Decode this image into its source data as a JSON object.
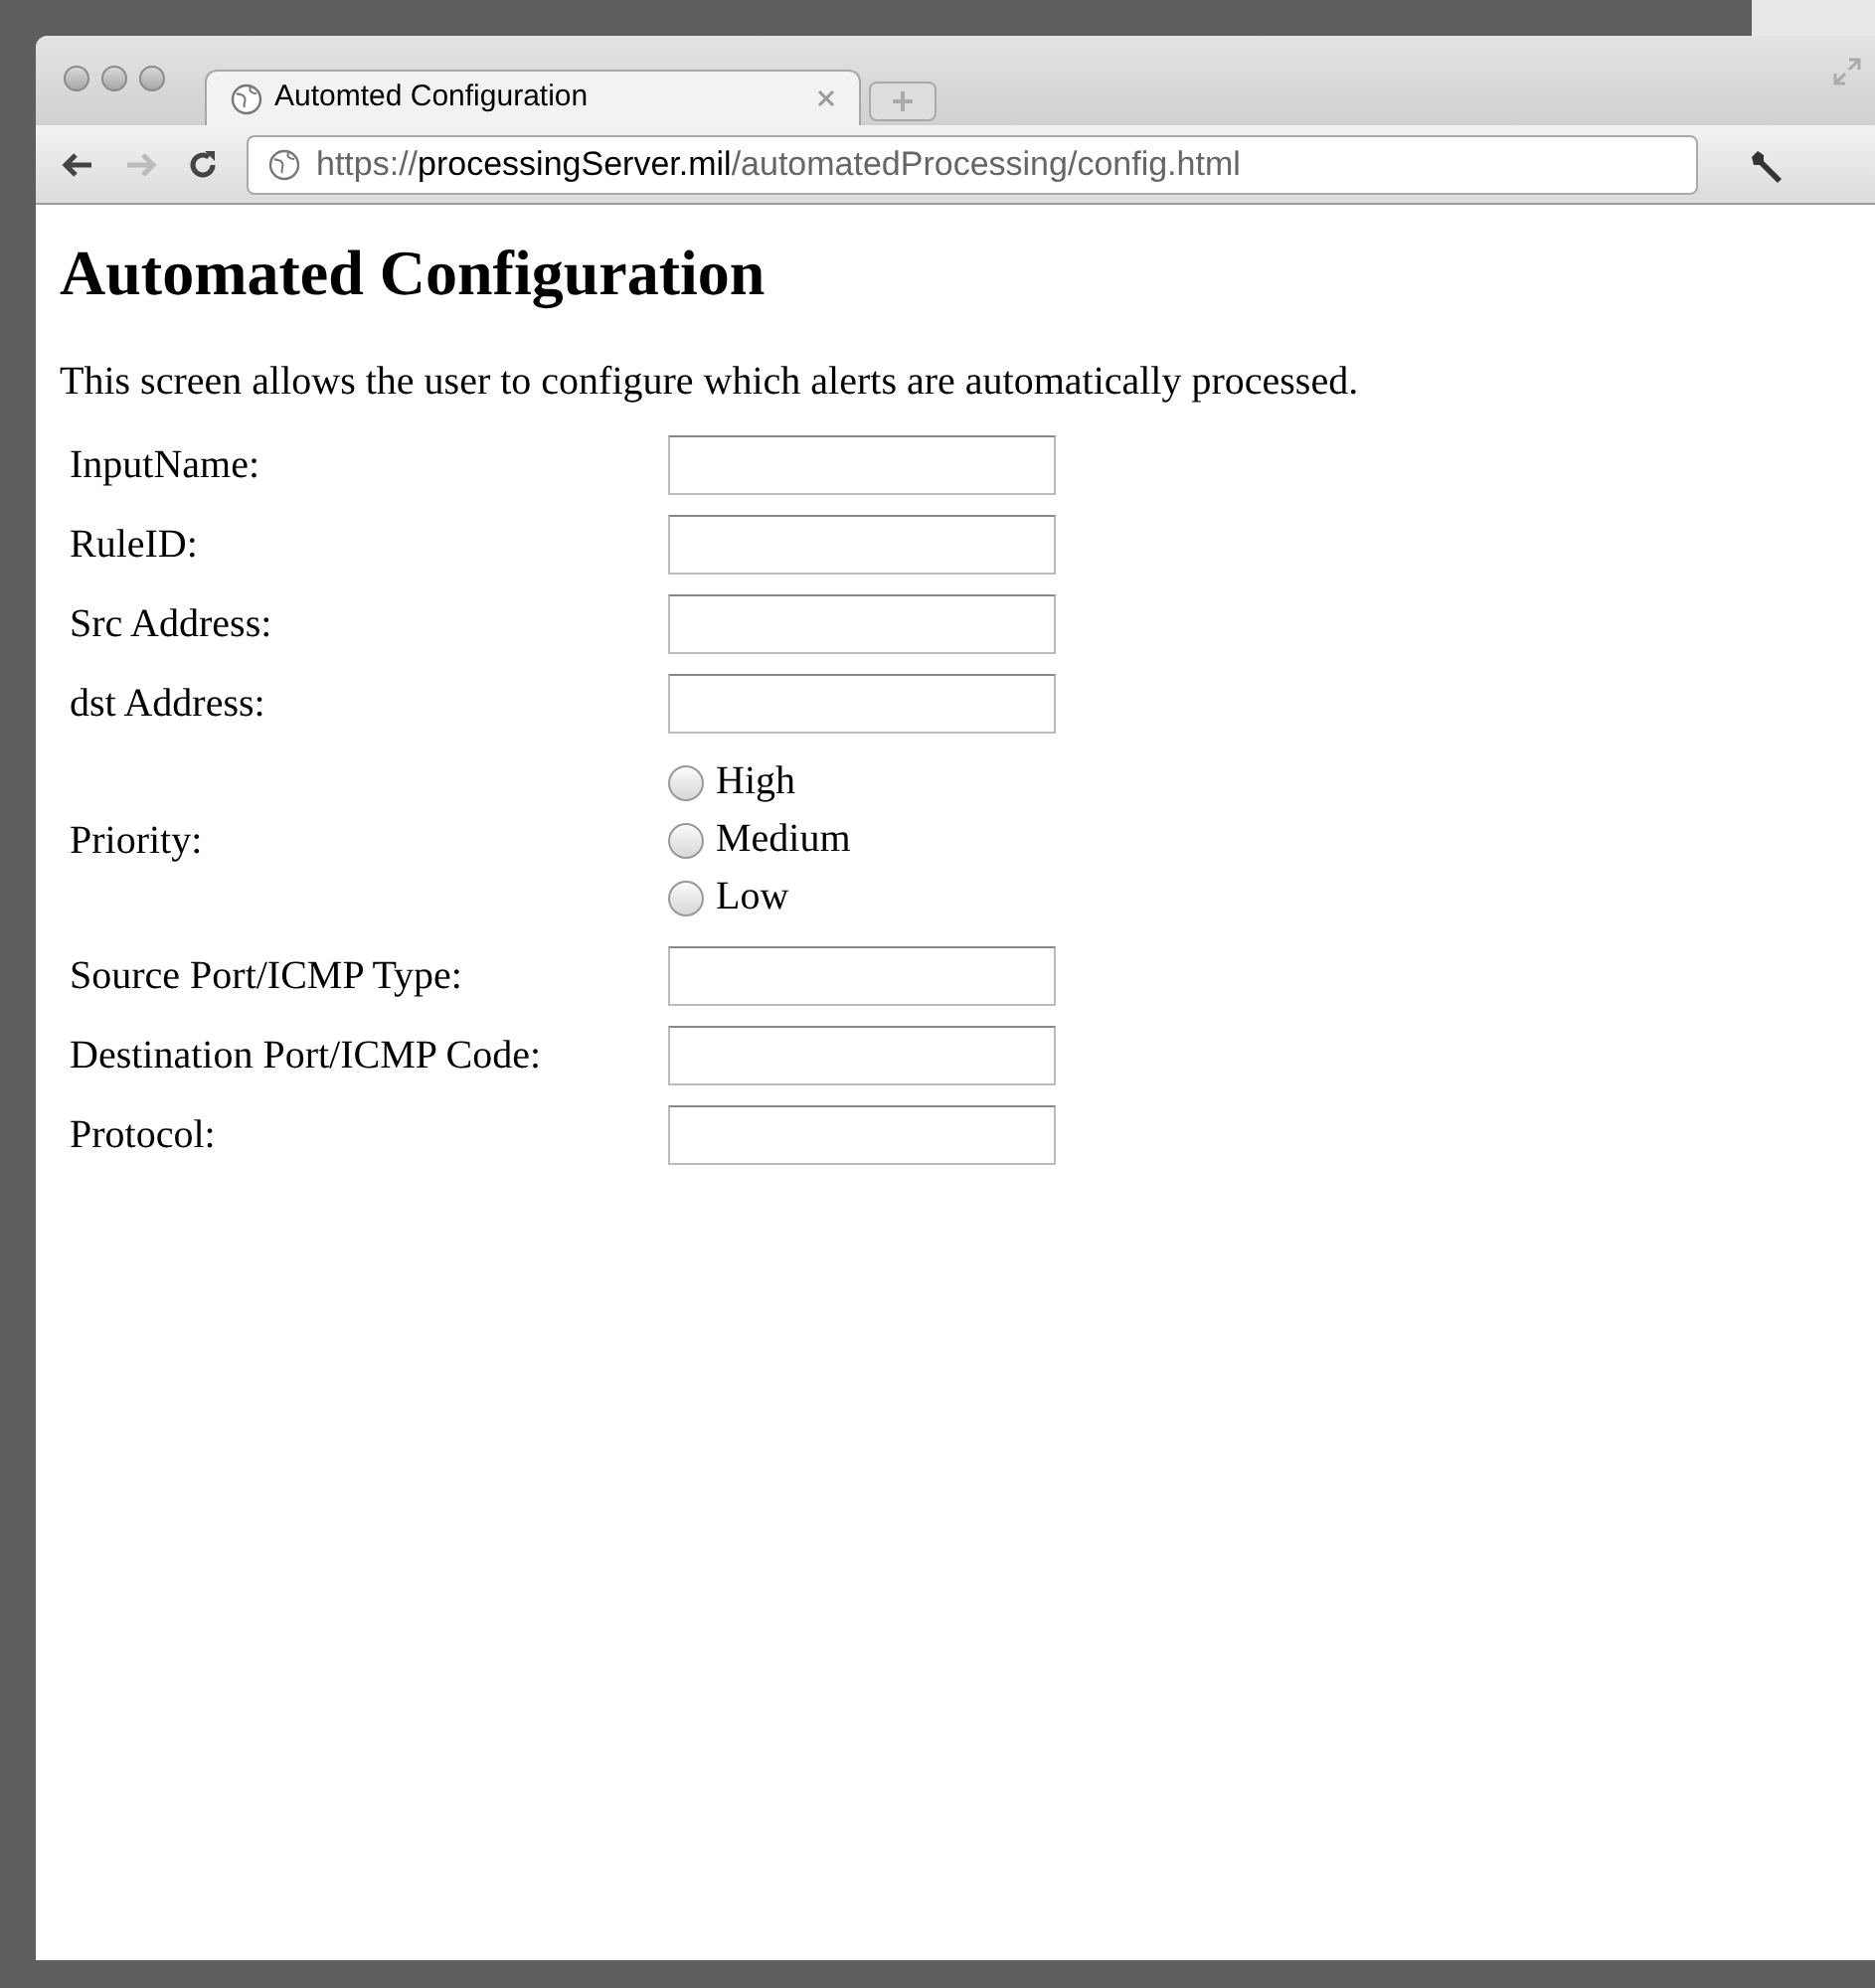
{
  "browser": {
    "tab": {
      "title": "Automted Configuration"
    },
    "url": "https://**processingServer.mil**/automatedProcessing/config.html"
  },
  "page": {
    "heading": "Automated Configuration",
    "description": "This screen allows the user to configure which alerts are automatically processed.",
    "fields": [
      {
        "kind": "text",
        "label": "InputName:"
      },
      {
        "kind": "text",
        "label": "RuleID:"
      },
      {
        "kind": "text",
        "label": "Src Address:"
      },
      {
        "kind": "text",
        "label": "dst Address:"
      },
      {
        "kind": "radio",
        "label": "Priority:",
        "options": [
          {
            "label": "High",
            "selected": false
          },
          {
            "label": "Medium",
            "selected": false
          },
          {
            "label": "Low",
            "selected": false
          }
        ]
      },
      {
        "kind": "text",
        "label": "Source Port/ICMP Type:"
      },
      {
        "kind": "text",
        "label": "Destination Port/ICMP Code:"
      },
      {
        "kind": "text",
        "label": "Protocol:"
      }
    ]
  }
}
